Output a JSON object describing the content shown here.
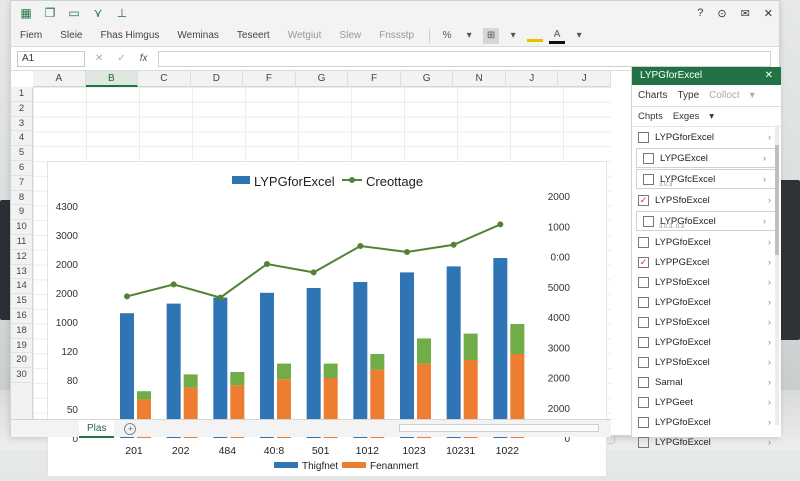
{
  "window": {
    "controls": [
      "?",
      "⊙",
      "✉",
      "✕"
    ],
    "quick_access": [
      "grid-icon",
      "copy-icon",
      "undo-icon",
      "redo-icon",
      "pin-icon"
    ]
  },
  "ribbon": {
    "tabs": [
      "Fiem",
      "Sleie",
      "Fhas Himgus",
      "Weminas",
      "Teseert",
      "Wetgiut",
      "Slew",
      "Fnssstp"
    ],
    "buttons": [
      "%",
      "▾",
      "⊞",
      "▾",
      "A",
      "▾"
    ]
  },
  "formula_bar": {
    "name_box": "A1",
    "icons": [
      "✕",
      "✓",
      "fx"
    ],
    "formula": ""
  },
  "columns": [
    "A",
    "B",
    "C",
    "D",
    "F",
    "G",
    "F",
    "G",
    "N",
    "J",
    "J"
  ],
  "selected_column": "B",
  "rows": [
    "1",
    "2",
    "3",
    "4",
    "5",
    "6",
    "7",
    "8",
    "9",
    "10",
    "11",
    "12",
    "13",
    "14",
    "15",
    "16",
    "18",
    "19",
    "20",
    "30"
  ],
  "chart_data": {
    "type": "bar",
    "title_series": [
      "LYPGforExcel",
      "Creottage"
    ],
    "categories": [
      "201",
      "202",
      "484",
      "40:8",
      "501",
      "1012",
      "1023",
      "10231",
      "1022"
    ],
    "left_axis_ticks": [
      "4300",
      "3000",
      "2000",
      "2000",
      "1000",
      "120",
      "80",
      "50",
      "0"
    ],
    "right_axis_ticks": [
      "2000",
      "1000",
      "0:00",
      "5000",
      "4000",
      "3000",
      "2000",
      "2000",
      "0"
    ],
    "series": [
      {
        "name": "Thigfnet",
        "kind": "bar",
        "color": "#2f75b5",
        "values": [
          1040,
          1120,
          1170,
          1210,
          1250,
          1300,
          1380,
          1430,
          1500
        ]
      },
      {
        "name": "Fenanmert",
        "kind": "stacked-bar",
        "color": "#ed7d31",
        "values": [
          320,
          420,
          440,
          490,
          500,
          570,
          620,
          650,
          700
        ]
      },
      {
        "name": "",
        "kind": "stacked-bar",
        "color": "#70ad47",
        "values": [
          70,
          110,
          110,
          130,
          120,
          130,
          210,
          220,
          250
        ]
      },
      {
        "name": "Creottage",
        "kind": "line",
        "color": "#548235",
        "values": [
          1180,
          1280,
          1170,
          1450,
          1380,
          1600,
          1550,
          1610,
          1780
        ]
      }
    ],
    "legend": [
      "Thigfnet",
      "Fenanmert"
    ],
    "legend_placement": "bottom"
  },
  "sheet_tabs": {
    "active": "Plas",
    "add": "+"
  },
  "pane": {
    "title": "LYPGforExcel",
    "tabs": [
      "Charts",
      "Type",
      "Colloct"
    ],
    "subtabs": [
      "Chpts",
      "Exges"
    ],
    "items": [
      {
        "label": "LYPGforExcel",
        "check": "",
        "boxed": false
      },
      {
        "label": "LYPGExcel",
        "check": "",
        "boxed": true,
        "sub": ""
      },
      {
        "label": "LYPGfcExcel",
        "check": "",
        "boxed": true,
        "sub": "3.0.3"
      },
      {
        "label": "LYPSfoExcel",
        "check": "✓",
        "boxed": false
      },
      {
        "label": "LYPGfoExcel",
        "check": "",
        "boxed": true,
        "sub": "3.0.3, 0.3"
      },
      {
        "label": "LYPGfoExcel",
        "check": "",
        "boxed": false
      },
      {
        "label": "LYPPGExcel",
        "check": "✓",
        "boxed": false
      },
      {
        "label": "LYPSfoExcel",
        "check": "",
        "boxed": false
      },
      {
        "label": "LYPGfoExcel",
        "check": "",
        "boxed": false
      },
      {
        "label": "LYPSfoExcel",
        "check": "",
        "boxed": false
      },
      {
        "label": "LYPGfoExcel",
        "check": "",
        "boxed": false
      },
      {
        "label": "LYPSfoExcel",
        "check": "",
        "boxed": false
      },
      {
        "label": "Sarnal",
        "check": "",
        "boxed": false
      },
      {
        "label": "LYPGeet",
        "check": "",
        "boxed": false
      },
      {
        "label": "LYPGfoExcel",
        "check": "",
        "boxed": false
      },
      {
        "label": "LYPGfoExcel",
        "check": "",
        "boxed": false
      }
    ]
  }
}
